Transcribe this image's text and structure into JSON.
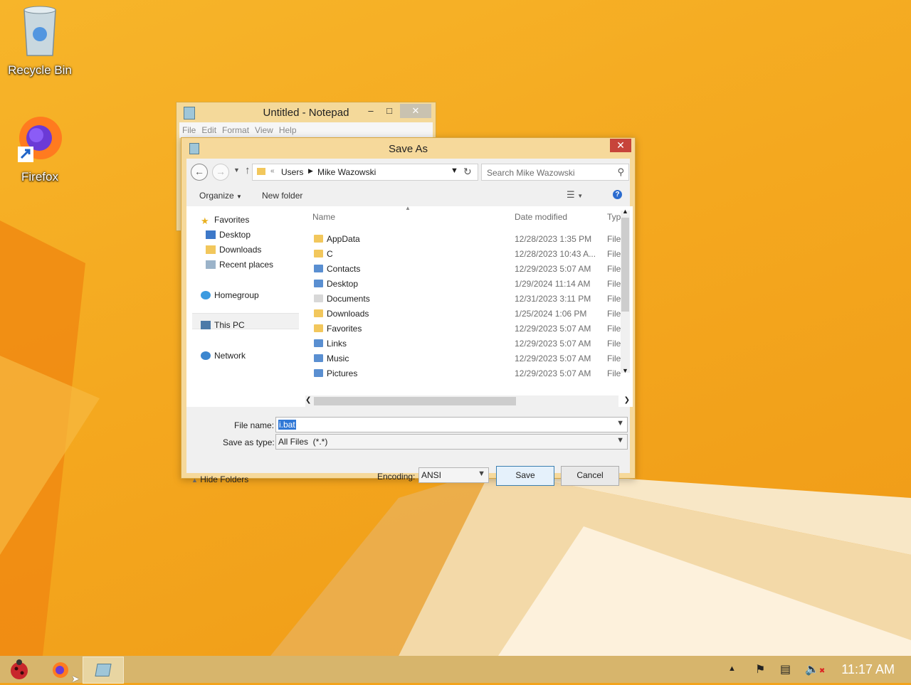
{
  "desktop": {
    "icons": [
      {
        "label": "Recycle Bin"
      },
      {
        "label": "Firefox"
      }
    ]
  },
  "notepad": {
    "title": "Untitled - Notepad",
    "menu": [
      "File",
      "Edit",
      "Format",
      "View",
      "Help"
    ]
  },
  "dialog": {
    "title": "Save As",
    "breadcrumb": [
      "Users",
      "Mike Wazowski"
    ],
    "search_placeholder": "Search Mike Wazowski",
    "commands": {
      "organize": "Organize",
      "new_folder": "New folder"
    },
    "nav": {
      "favorites": "Favorites",
      "desktop": "Desktop",
      "downloads": "Downloads",
      "recent": "Recent places",
      "homegroup": "Homegroup",
      "this_pc": "This PC",
      "network": "Network"
    },
    "columns": {
      "name": "Name",
      "date": "Date modified",
      "type": "Typ"
    },
    "files": [
      {
        "name": "AppData",
        "date": "12/28/2023 1:35 PM",
        "type": "File"
      },
      {
        "name": "C",
        "date": "12/28/2023 10:43 A...",
        "type": "File"
      },
      {
        "name": "Contacts",
        "date": "12/29/2023 5:07 AM",
        "type": "File"
      },
      {
        "name": "Desktop",
        "date": "1/29/2024 11:14 AM",
        "type": "File"
      },
      {
        "name": "Documents",
        "date": "12/31/2023 3:11 PM",
        "type": "File"
      },
      {
        "name": "Downloads",
        "date": "1/25/2024 1:06 PM",
        "type": "File"
      },
      {
        "name": "Favorites",
        "date": "12/29/2023 5:07 AM",
        "type": "File"
      },
      {
        "name": "Links",
        "date": "12/29/2023 5:07 AM",
        "type": "File"
      },
      {
        "name": "Music",
        "date": "12/29/2023 5:07 AM",
        "type": "File"
      },
      {
        "name": "Pictures",
        "date": "12/29/2023 5:07 AM",
        "type": "File"
      }
    ],
    "file_name_label": "File name:",
    "file_name_value": "i.bat",
    "save_type_label": "Save as type:",
    "save_type_value": "All Files  (*.*)",
    "hide_folders": "Hide Folders",
    "encoding_label": "Encoding:",
    "encoding_value": "ANSI",
    "save_button": "Save",
    "cancel_button": "Cancel"
  },
  "taskbar": {
    "clock": "11:17 AM"
  },
  "colors": {
    "desktop": "#f4a81f",
    "window_frame": "#f6d99b",
    "close_red": "#c7443a",
    "selection_blue": "#3078d6"
  }
}
